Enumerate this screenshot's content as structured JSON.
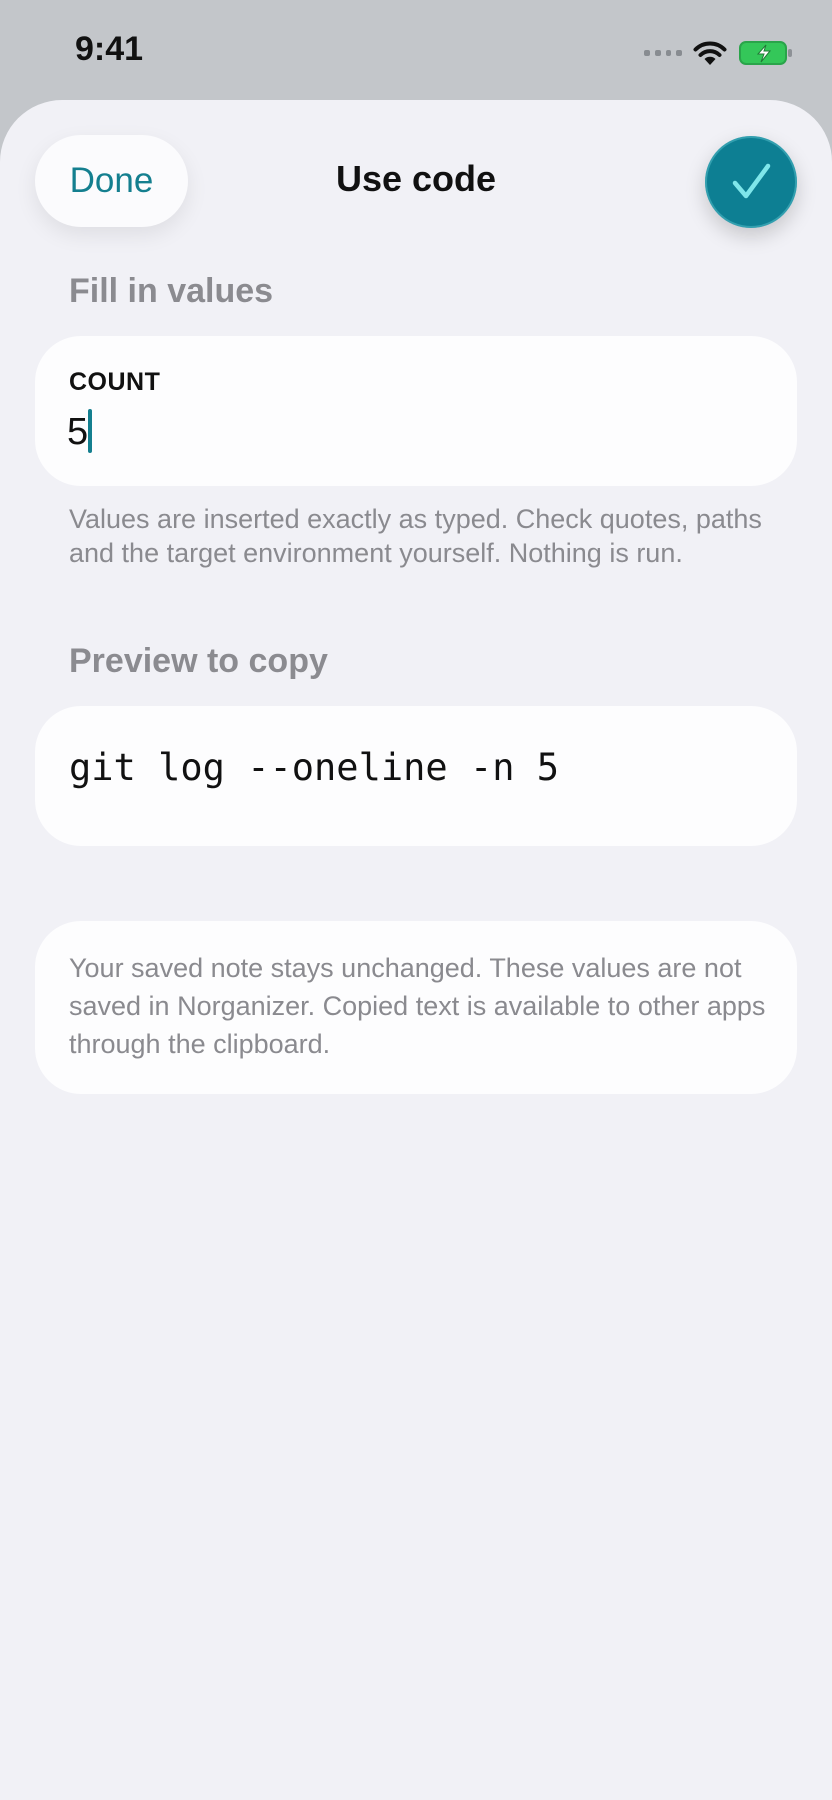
{
  "status_bar": {
    "time": "9:41",
    "icons": [
      "signal-icon",
      "wifi-icon",
      "battery-charging-icon"
    ],
    "battery_color": "#34c759"
  },
  "nav": {
    "done_label": "Done",
    "title": "Use code",
    "confirm_icon": "checkmark-icon",
    "accent_color": "#147f8f"
  },
  "fill_section": {
    "header": "Fill in values",
    "field_label": "COUNT",
    "field_value": "5",
    "help": "Values are inserted exactly as typed. Check quotes, paths and the target environment yourself. Nothing is run."
  },
  "preview_section": {
    "header": "Preview to copy",
    "code": "git log --oneline -n 5"
  },
  "note": {
    "text": "Your saved note stays unchanged. These values are not saved in Norganizer. Copied text is available to other apps through the clipboard."
  }
}
